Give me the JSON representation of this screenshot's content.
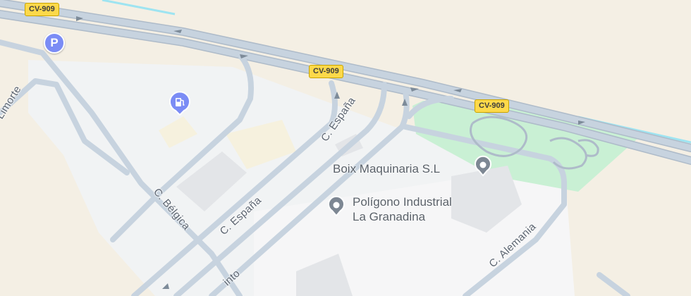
{
  "roads": {
    "highway_shields": [
      {
        "label": "CV-909"
      },
      {
        "label": "CV-909"
      },
      {
        "label": "CV-909"
      }
    ],
    "streets": [
      {
        "name": "Limorte"
      },
      {
        "name": "C. España"
      },
      {
        "name": "C. España"
      },
      {
        "name": "C. Bélgica"
      },
      {
        "name": "C. Alemania"
      },
      {
        "name": "into"
      }
    ]
  },
  "places": [
    {
      "name": "Boix Maquinaria S.L",
      "icon": "location-pin-icon"
    },
    {
      "name_line1": "Polígono Industrial",
      "name_line2": "La Granadina",
      "icon": "location-pin-icon"
    }
  ],
  "markers": {
    "parking": {
      "label": "P",
      "icon": "parking-icon",
      "color": "#7b8cf5"
    },
    "fuel": {
      "icon": "fuel-station-icon",
      "color": "#7b8cf5"
    }
  },
  "colors": {
    "land": "#f4efe4",
    "industrial": "#f1f3f4",
    "park": "#c9f0d4",
    "road": "#c7d3df",
    "road_edge": "#aebbc9",
    "water": "#9ee4f1",
    "shield": "#fdd94a"
  }
}
